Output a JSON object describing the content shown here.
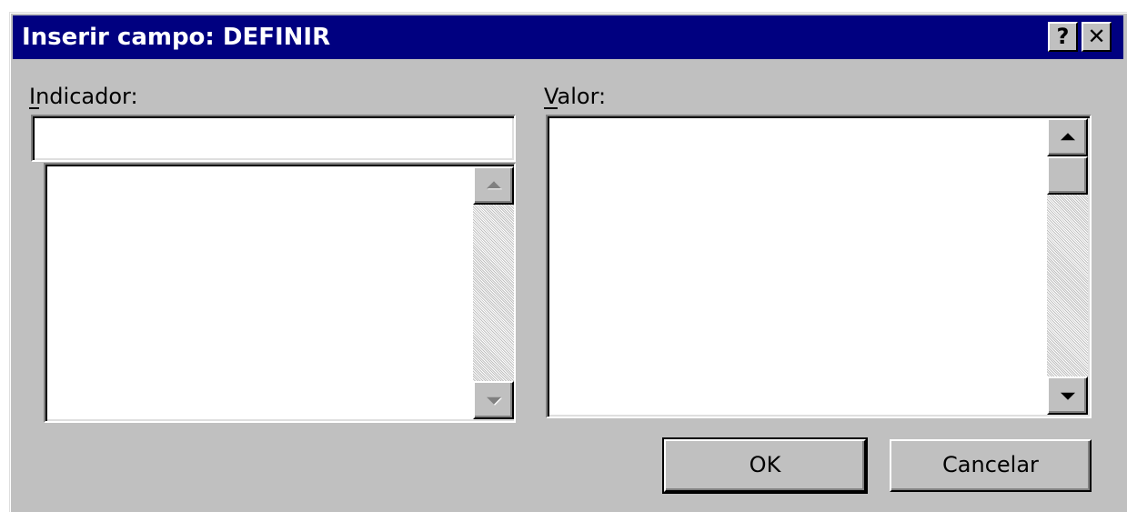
{
  "window": {
    "title": "Inserir campo: DEFINIR",
    "help_glyph": "?",
    "close_glyph": "✕"
  },
  "bookmark": {
    "label": "Indicador:",
    "input_value": "",
    "list_items": []
  },
  "value": {
    "label": "Valor:",
    "text": ""
  },
  "buttons": {
    "ok": "OK",
    "cancel": "Cancelar"
  }
}
